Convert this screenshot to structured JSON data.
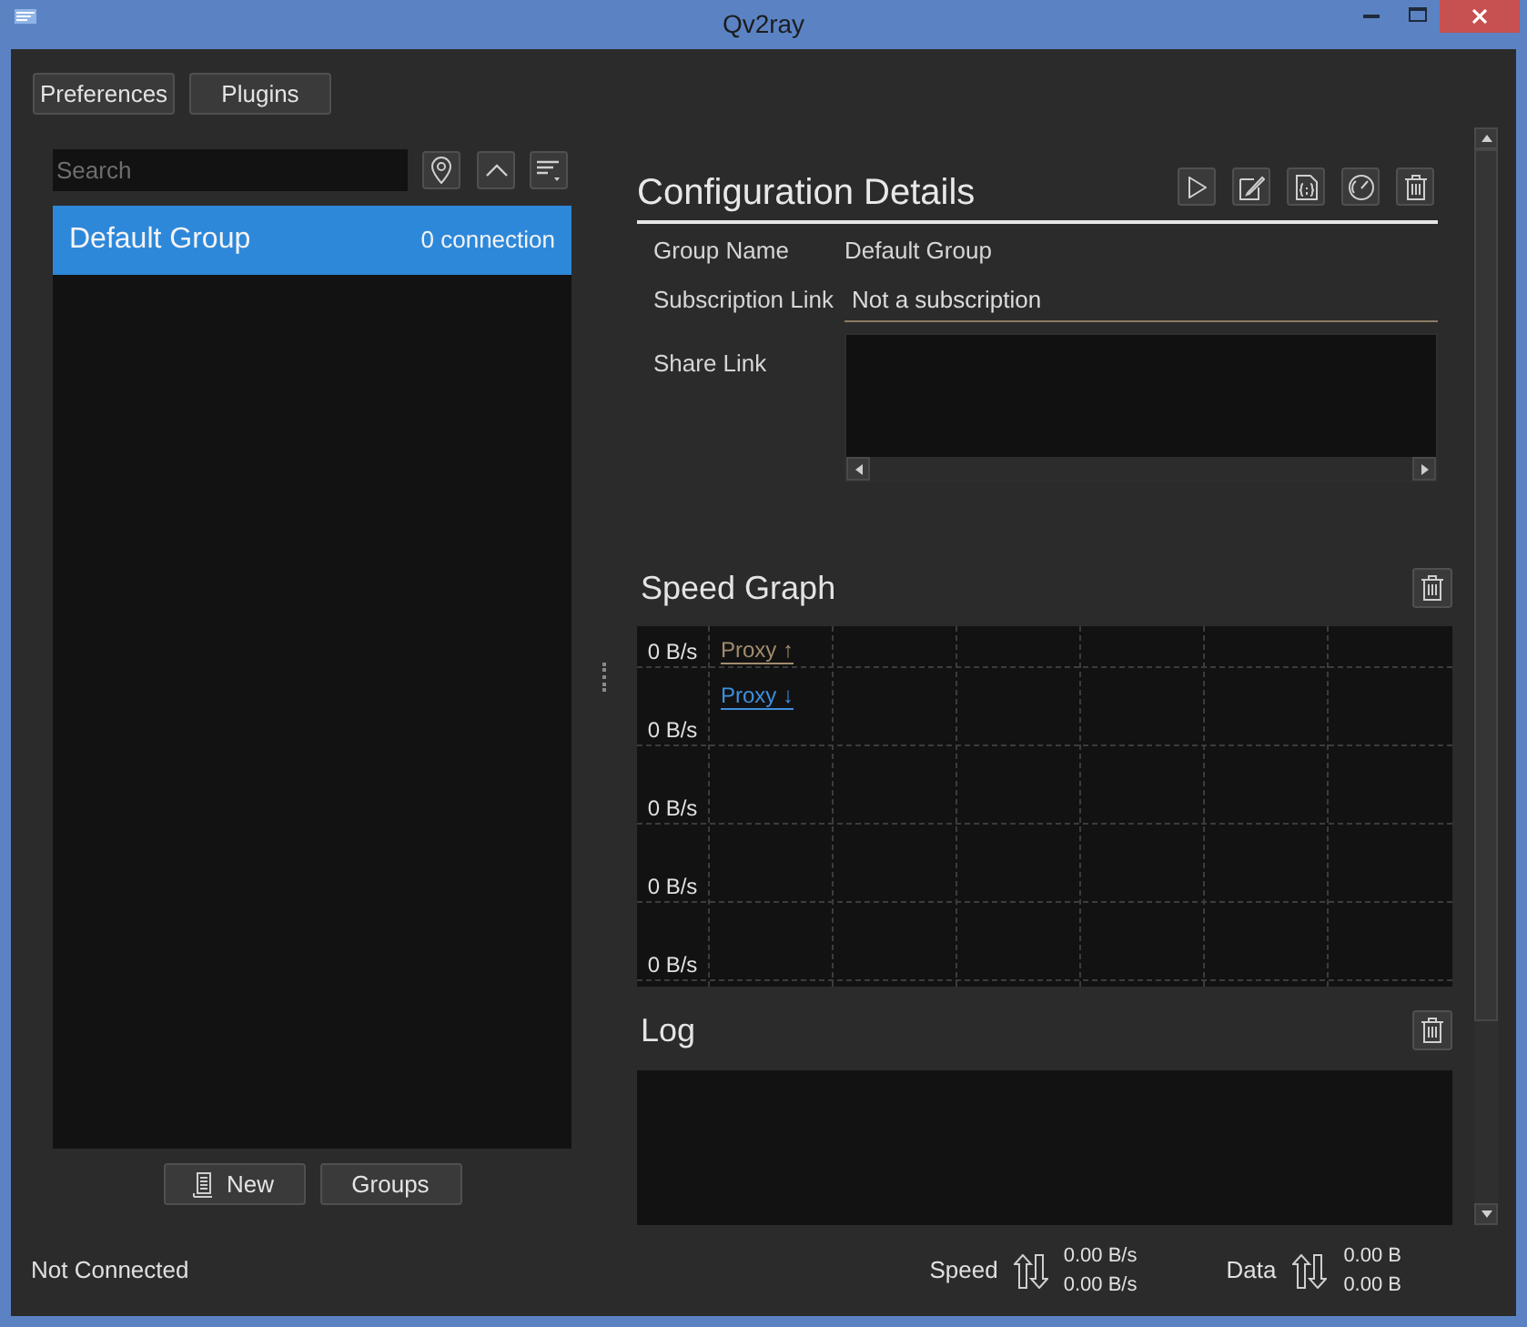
{
  "window": {
    "title": "Qv2ray"
  },
  "toolbar_buttons": [
    "Preferences",
    "Plugins"
  ],
  "groups_panel": {
    "search": {
      "placeholder": "Search"
    },
    "groups": [
      {
        "name": "Default Group",
        "count": "0 connection",
        "selected": true
      }
    ],
    "buttons": [
      {
        "label": "New",
        "has_icon": true
      },
      {
        "label": "Groups",
        "has_icon": false
      }
    ]
  },
  "configuration_details": {
    "title": "Configuration Details",
    "fields": [
      {
        "kind": "text",
        "label": "Group Name",
        "value": "Default Group"
      },
      {
        "kind": "line",
        "label": "Subscription Link",
        "value": "Not a subscription"
      },
      {
        "kind": "area",
        "label": "Share Link"
      }
    ]
  },
  "speed_graph": {
    "title": "Speed Graph",
    "y_labels": [
      "0 B/s",
      "0 B/s",
      "0 B/s",
      "0 B/s",
      "0 B/s"
    ],
    "legend": [
      {
        "label": "Proxy ↑",
        "color": "#a38c6e"
      },
      {
        "label": "Proxy ↓",
        "color": "#3f8fdc"
      }
    ]
  },
  "log": {
    "title": "Log"
  },
  "status_bar": {
    "connection": "Not Connected",
    "speed": {
      "label": "Speed",
      "values": [
        "0.00 B/s",
        "0.00 B/s"
      ]
    },
    "data": {
      "label": "Data",
      "values": [
        "0.00 B",
        "0.00 B"
      ]
    }
  }
}
